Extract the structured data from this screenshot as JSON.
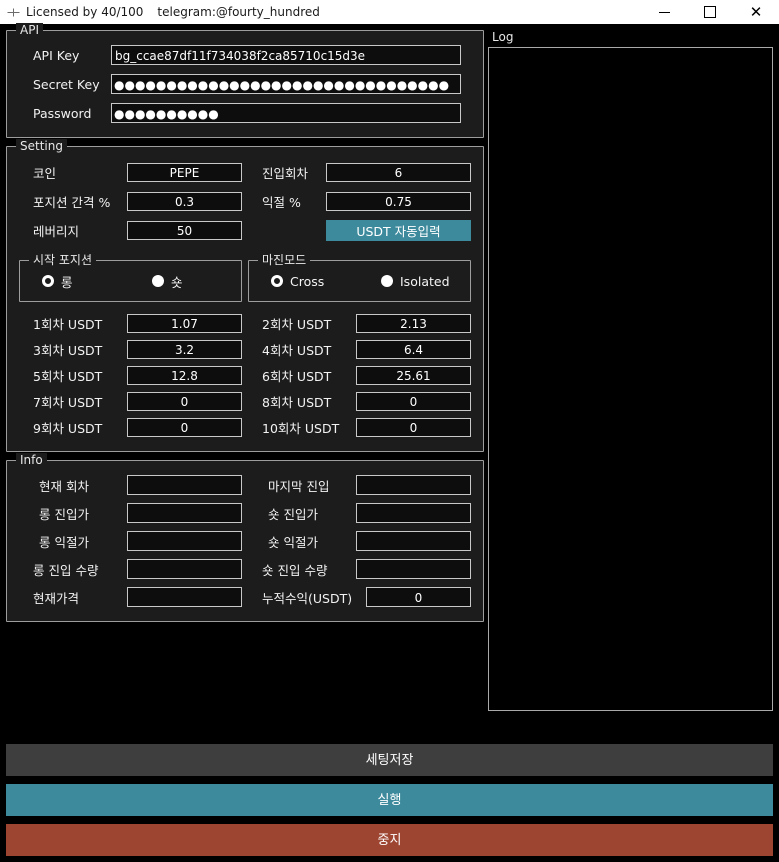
{
  "titlebar": {
    "app_icon": "crosshair-icon",
    "license_text": "Licensed by 40/100",
    "telegram_text": "telegram:@fourty_hundred",
    "minimize_label": "",
    "maximize_label": "",
    "close_label": "✕"
  },
  "api": {
    "group_title": "API",
    "fields": [
      {
        "label": "API Key",
        "value": "bg_ccae87df11f734038f2ca85710c15d3e",
        "masked": false
      },
      {
        "label": "Secret Key",
        "value": "●●●●●●●●●●●●●●●●●●●●●●●●●●●●●●●●",
        "masked": true
      },
      {
        "label": "Password",
        "value": "●●●●●●●●●●",
        "masked": true
      }
    ]
  },
  "setting": {
    "group_title": "Setting",
    "coin_label": "코인",
    "coin_value": "PEPE",
    "entries_label": "진입회차",
    "entries_value": "6",
    "gap_label": "포지션 간격 %",
    "gap_value": "0.3",
    "takeprofit_label": "익절 %",
    "takeprofit_value": "0.75",
    "leverage_label": "레버리지",
    "leverage_value": "50",
    "usdt_auto_button": "USDT 자동입력",
    "start_position": {
      "group_title": "시작 포지션",
      "options": [
        {
          "label": "롱",
          "selected": true
        },
        {
          "label": "숏",
          "selected": false
        }
      ]
    },
    "margin_mode": {
      "group_title": "마진모드",
      "options": [
        {
          "label": "Cross",
          "selected": true
        },
        {
          "label": "Isolated",
          "selected": false
        }
      ]
    },
    "rounds": [
      {
        "label": "1회차 USDT",
        "value": "1.07"
      },
      {
        "label": "2회차 USDT",
        "value": "2.13"
      },
      {
        "label": "3회차 USDT",
        "value": "3.2"
      },
      {
        "label": "4회차 USDT",
        "value": "6.4"
      },
      {
        "label": "5회차 USDT",
        "value": "12.8"
      },
      {
        "label": "6회차 USDT",
        "value": "25.61"
      },
      {
        "label": "7회차 USDT",
        "value": "0"
      },
      {
        "label": "8회차 USDT",
        "value": "0"
      },
      {
        "label": "9회차 USDT",
        "value": "0"
      },
      {
        "label": "10회차 USDT",
        "value": "0"
      }
    ]
  },
  "info": {
    "group_title": "Info",
    "fields": [
      {
        "label": "현재 회차",
        "value": ""
      },
      {
        "label": "마지막 진입",
        "value": ""
      },
      {
        "label": "롱 진입가",
        "value": ""
      },
      {
        "label": "숏 진입가",
        "value": ""
      },
      {
        "label": "롱 익절가",
        "value": ""
      },
      {
        "label": "숏 익절가",
        "value": ""
      },
      {
        "label": "롱 진입 수량",
        "value": ""
      },
      {
        "label": "숏 진입 수량",
        "value": ""
      },
      {
        "label": "현재가격",
        "value": ""
      },
      {
        "label": "누적수익(USDT)",
        "value": "0"
      }
    ]
  },
  "log": {
    "title": "Log",
    "content": ""
  },
  "actions": {
    "save_label": "세팅저장",
    "run_label": "실행",
    "stop_label": "중지"
  },
  "colors": {
    "window_bg": "#000000",
    "panel_bg": "#1c1c1c",
    "field_bg": "#0d0d0d",
    "border": "#9d9d9d",
    "accent_teal": "#3d8a9c",
    "accent_red": "#9e4532",
    "button_gray": "#3e3e3e",
    "text": "#f2f2f2"
  }
}
